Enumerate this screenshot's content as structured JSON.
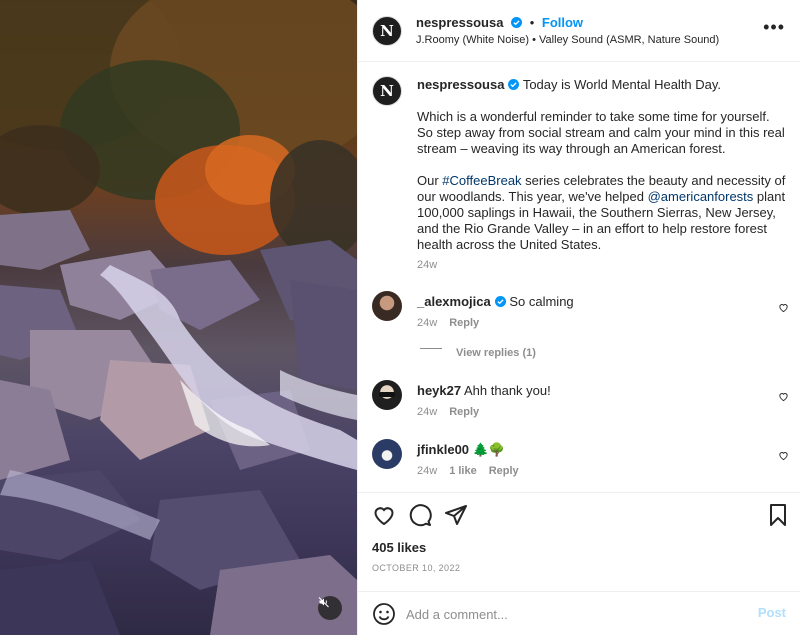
{
  "post": {
    "author": "nespressousa",
    "follow_label": "Follow",
    "audio": "J.Roomy (White Noise) • Valley Sound (ASMR, Nature Sound)",
    "avatar_letter": "N",
    "caption_lead": "Today is World Mental Health Day.",
    "caption_p2": "Which is a wonderful reminder to take some time for yourself. So step away from social stream and calm your mind in this real stream – weaving its way through an American forest.",
    "caption_p3_a": "Our ",
    "caption_p3_hashtag": "#CoffeeBreak",
    "caption_p3_b": " series celebrates the beauty and necessity of our woodlands. This year, we've helped ",
    "caption_p3_mention": "@americanforests",
    "caption_p3_c": " plant 100,000 saplings in Hawaii, the Southern Sierras, New Jersey, and the Rio Grande Valley – in an effort to help restore forest health across the United States.",
    "caption_time": "24w",
    "likes": "405 likes",
    "date": "OCTOBER 10, 2022"
  },
  "comments": [
    {
      "user": "_alexmojica",
      "verified": true,
      "text": "So calming",
      "time": "24w",
      "reply": "Reply",
      "likes": "",
      "view_replies": "View replies (1)"
    },
    {
      "user": "heyk27",
      "verified": false,
      "text": "Ahh thank you!",
      "time": "24w",
      "reply": "Reply",
      "likes": ""
    },
    {
      "user": "jfinkle00",
      "verified": false,
      "text": "🌲🌳",
      "time": "24w",
      "reply": "Reply",
      "likes": "1 like"
    }
  ],
  "comment_bar": {
    "placeholder": "Add a comment...",
    "post_label": "Post"
  },
  "icons": {
    "more": "more-options-icon",
    "verified": "verified-badge-icon",
    "heart": "heart-icon",
    "comment": "comment-icon",
    "share": "share-icon",
    "save": "bookmark-icon",
    "emoji": "emoji-icon",
    "mute": "muted-speaker-icon"
  },
  "colors": {
    "link_blue": "#0095f6",
    "mention": "#00376b",
    "muted_text": "#8e8e8e",
    "post_disabled": "#b2dffc"
  }
}
